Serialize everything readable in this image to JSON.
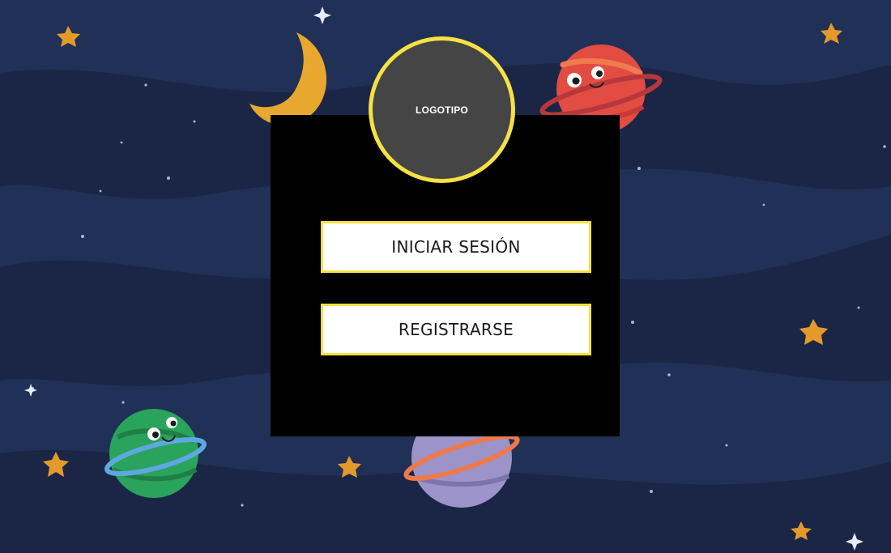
{
  "logo": {
    "text": "LOGOTIPO"
  },
  "buttons": {
    "login_label": "INICIAR SESIÓN",
    "register_label": "REGISTRARSE"
  },
  "colors": {
    "background": "#1f2c4e",
    "panel": "#000000",
    "accent": "#f5e143",
    "logo_fill": "#454545"
  }
}
